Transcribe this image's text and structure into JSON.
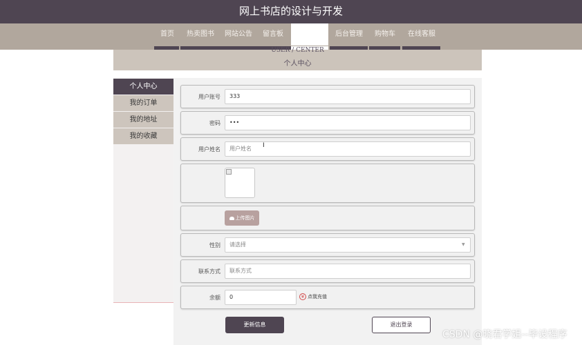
{
  "header": {
    "title": "网上书店的设计与开发"
  },
  "nav": {
    "items": [
      {
        "label": "首页"
      },
      {
        "label": "热卖图书"
      },
      {
        "label": "网站公告"
      },
      {
        "label": "留言板"
      },
      {
        "label": "个人中心",
        "active": true
      },
      {
        "label": "后台管理"
      },
      {
        "label": "购物车"
      },
      {
        "label": "在线客服"
      }
    ]
  },
  "banner": {
    "en": "USER / CENTER",
    "cn": "个人中心"
  },
  "sidebar": {
    "items": [
      {
        "label": "个人中心",
        "active": true
      },
      {
        "label": "我的订单"
      },
      {
        "label": "我的地址"
      },
      {
        "label": "我的收藏"
      }
    ]
  },
  "form": {
    "account": {
      "label": "用户账号",
      "value": "333"
    },
    "password": {
      "label": "密码",
      "value": "•••"
    },
    "name": {
      "label": "用户姓名",
      "placeholder": "用户姓名"
    },
    "upload_label": "上传图片",
    "gender": {
      "label": "性别",
      "selected": "请选择"
    },
    "phone": {
      "label": "联系方式",
      "placeholder": "联系方式"
    },
    "balance": {
      "label": "余额",
      "value": "0"
    },
    "recharge_label": "点我充值",
    "update_button": "更新信息",
    "logout_button": "退出登录"
  },
  "watermark": "CSDN @晓君学姐--毕设程序",
  "colors": {
    "primary": "#4f4552",
    "nav_bg": "#b1a79d",
    "sidebar_item": "#cdc5bd"
  },
  "icons": [
    "cloud-upload-icon",
    "recharge-icon",
    "chevron-down-icon",
    "broken-image-icon"
  ]
}
